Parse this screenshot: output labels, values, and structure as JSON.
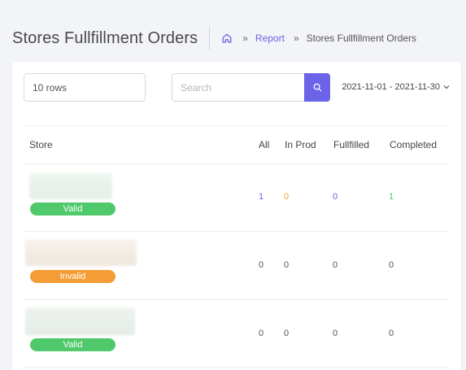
{
  "header": {
    "title": "Stores Fullfillment Orders",
    "breadcrumb": {
      "home_icon": "home-icon",
      "separator": "»",
      "report": "Report",
      "current": "Stores Fullfillment Orders"
    }
  },
  "toolbar": {
    "rows_value": "10 rows",
    "search_placeholder": "Search",
    "search_icon": "search-icon",
    "date_range": "2021-11-01 - 2021-11-30",
    "accent_color": "#6b63e8"
  },
  "table": {
    "columns": [
      "Store",
      "All",
      "In Prod",
      "Fullfilled",
      "Completed"
    ],
    "rows": [
      {
        "status": "Valid",
        "all": "1",
        "in_prod": "0",
        "fullfilled": "0",
        "completed": "1"
      },
      {
        "status": "Invalid",
        "all": "0",
        "in_prod": "0",
        "fullfilled": "0",
        "completed": "0"
      },
      {
        "status": "Valid",
        "all": "0",
        "in_prod": "0",
        "fullfilled": "0",
        "completed": "0"
      }
    ]
  },
  "colors": {
    "valid": "#4fc96b",
    "invalid": "#f49d36",
    "all_link": "#6b63e8",
    "in_prod_link": "#f49d36",
    "fullfilled_link": "#6b63e8",
    "completed_link": "#4fc96b"
  }
}
